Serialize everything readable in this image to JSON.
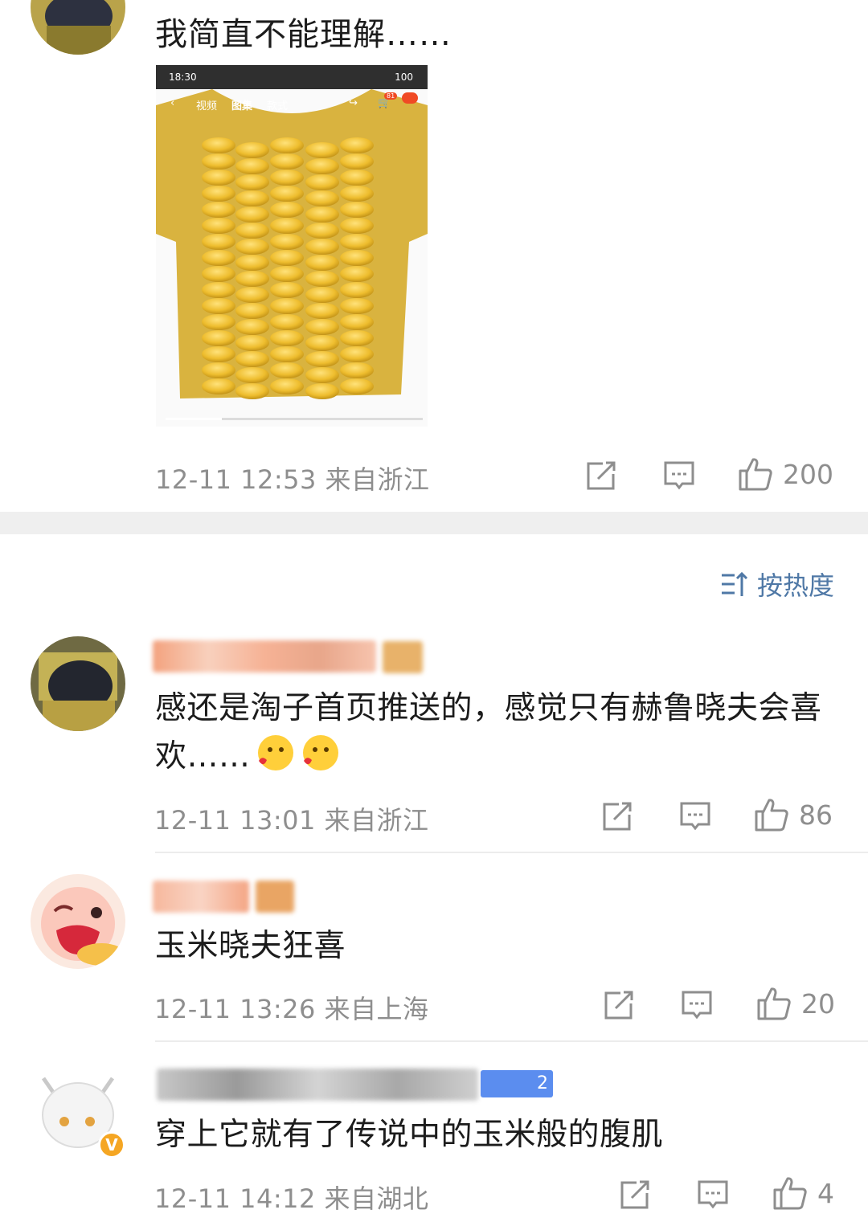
{
  "post": {
    "text": "我简直不能理解……",
    "meta": "12-11 12:53  来自浙江",
    "like_count": "200",
    "photo": {
      "status_time": "18:30",
      "status_battery": "100",
      "tabs": [
        "视频",
        "图集",
        "款式"
      ],
      "cart_badge": "81"
    }
  },
  "sort": {
    "label": "按热度"
  },
  "comments": [
    {
      "text": "感还是淘子首页推送的，感觉只有赫鲁晓夫会喜欢……",
      "meta": "12-11 13:01  来自浙江",
      "like_count": "86"
    },
    {
      "text": "玉米晓夫狂喜",
      "meta": "12-11 13:26  来自上海",
      "like_count": "20"
    },
    {
      "text": "穿上它就有了传说中的玉米般的腹肌",
      "meta": "12-11 14:12  来自湖北",
      "like_count": "4",
      "badge_level": "2"
    }
  ],
  "colors": {
    "accent": "#4f78a6",
    "meta_gray": "#8e8e8e",
    "corn": "#f0c53a"
  }
}
